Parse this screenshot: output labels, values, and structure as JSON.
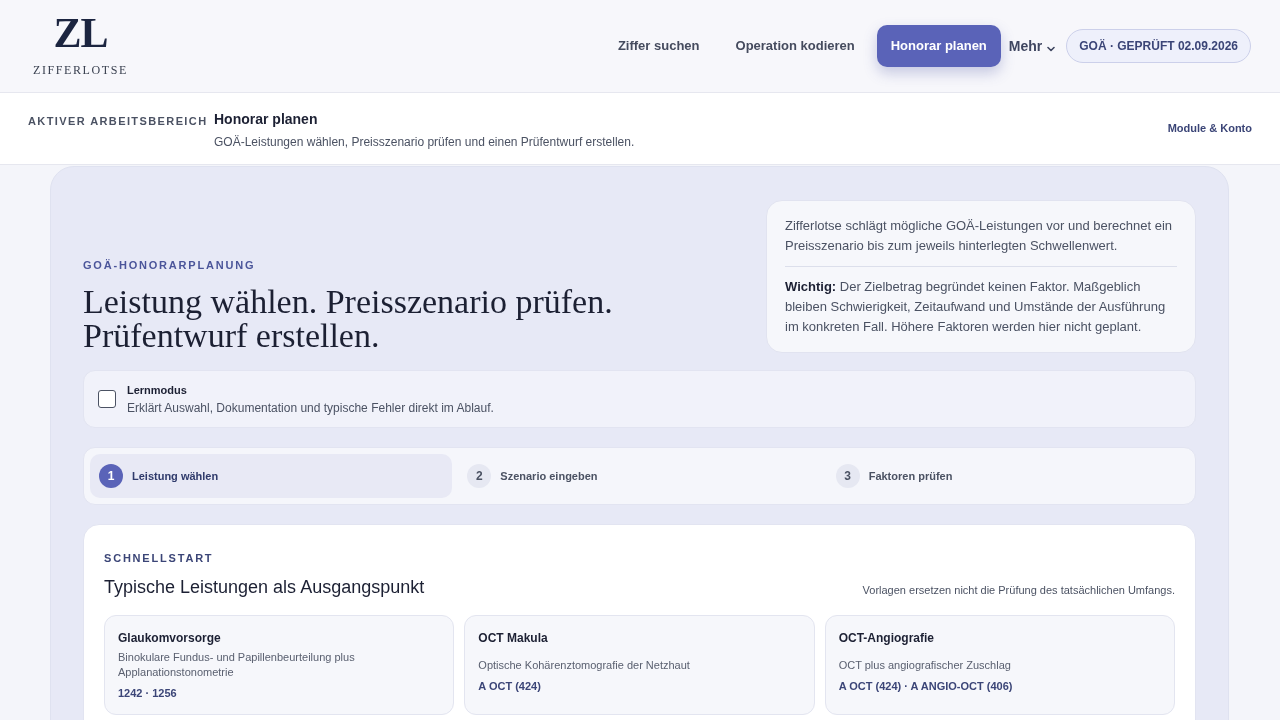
{
  "header": {
    "logo": {
      "mark": "ZL",
      "name": "ZIFFERLOTSE"
    },
    "nav": [
      {
        "label": "Ziffer suchen",
        "selected": false
      },
      {
        "label": "Operation kodieren",
        "selected": false
      },
      {
        "label": "Honorar planen",
        "selected": true
      }
    ],
    "more_menu": {
      "label": "Mehr"
    },
    "status_badge": "GOÄ · GEPRÜFT 02.09.2026"
  },
  "workspace_bar": {
    "label": "AKTIVER ARBEITSBEREICH",
    "title": "Honorar planen",
    "description": "GOÄ-Leistungen wählen, Preisszenario prüfen und einen Prüfentwurf erstellen.",
    "account_link": "Module & Konto"
  },
  "hero": {
    "eyebrow": "GOÄ-HONORARPLANUNG",
    "title": "Leistung wählen. Preisszenario prüfen. Prüfentwurf erstellen.",
    "info": {
      "text": "Zifferlotse schlägt mögliche GOÄ-Leistungen vor und berechnet ein Preisszenario bis zum jeweils hinterlegten Schwellenwert.",
      "note": "**Wichtig:** Der Zielbetrag begründet keinen Faktor. Maßgeblich bleiben Schwierigkeit, Zeitaufwand und Umstände der Ausführung im konkreten Fall. Höhere Faktoren werden hier nicht geplant."
    }
  },
  "learning_mode": {
    "label": "Lernmodus",
    "description": "Erklärt Auswahl, Dokumentation und typische Fehler direkt im Ablauf.",
    "checked": false
  },
  "steps": [
    {
      "number": "1",
      "label": "Leistung wählen",
      "selected": true
    },
    {
      "number": "2",
      "label": "Szenario eingeben",
      "selected": false
    },
    {
      "number": "3",
      "label": "Faktoren prüfen",
      "selected": false
    }
  ],
  "quickstart": {
    "eyebrow": "SCHNELLSTART",
    "title": "Typische Leistungen als Ausgangspunkt",
    "note": "Vorlagen ersetzen nicht die Prüfung des tatsächlichen Umfangs.",
    "templates": [
      {
        "title": "Glaukomvorsorge",
        "description": "Binokulare Fundus- und Papillenbeurteilung plus Applanationstonometrie",
        "codes": "1242 · 1256"
      },
      {
        "title": "OCT Makula",
        "description": "Optische Kohärenztomografie der Netzhaut",
        "codes": "A OCT (424)"
      },
      {
        "title": "OCT-Angiografie",
        "description": "OCT plus angiografischer Zuschlag",
        "codes": "A OCT (424) · A ANGIO-OCT (406)"
      }
    ]
  }
}
